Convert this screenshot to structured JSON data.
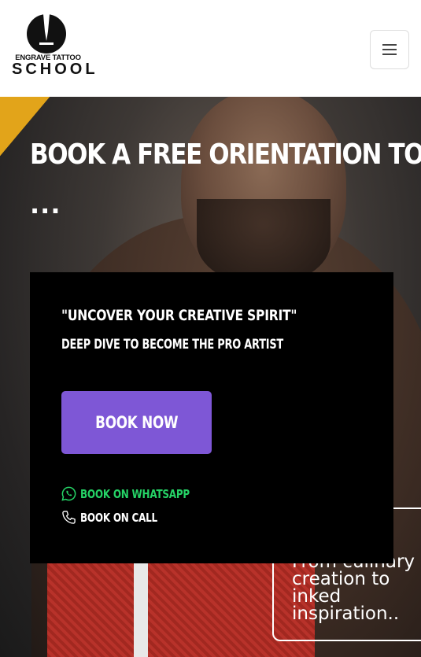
{
  "header": {
    "logo_line1": "ENGRAVE TATTOO",
    "logo_line2": "SCHOOL",
    "logo_icon": "tattoo-needle-logo-icon",
    "menu_icon": "hamburger-menu-icon"
  },
  "hero": {
    "title": "BOOK A FREE ORIENTATION TODAY",
    "ellipsis": "...",
    "background_text": "From culinary creation to inked inspiration.."
  },
  "card": {
    "quote": "\"UNCOVER YOUR CREATIVE SPIRIT\"",
    "subheading": "DEEP DIVE TO BECOME THE PRO ARTIST",
    "book_button": "BOOK NOW",
    "whatsapp_label": "BOOK ON WHATSAPP",
    "call_label": "BOOK ON CALL",
    "whatsapp_icon": "whatsapp-icon",
    "call_icon": "phone-icon"
  },
  "colors": {
    "accent": "#7e57d6",
    "whatsapp": "#25d366",
    "card_bg": "#000000",
    "highlight_yellow": "#e2a41a"
  }
}
